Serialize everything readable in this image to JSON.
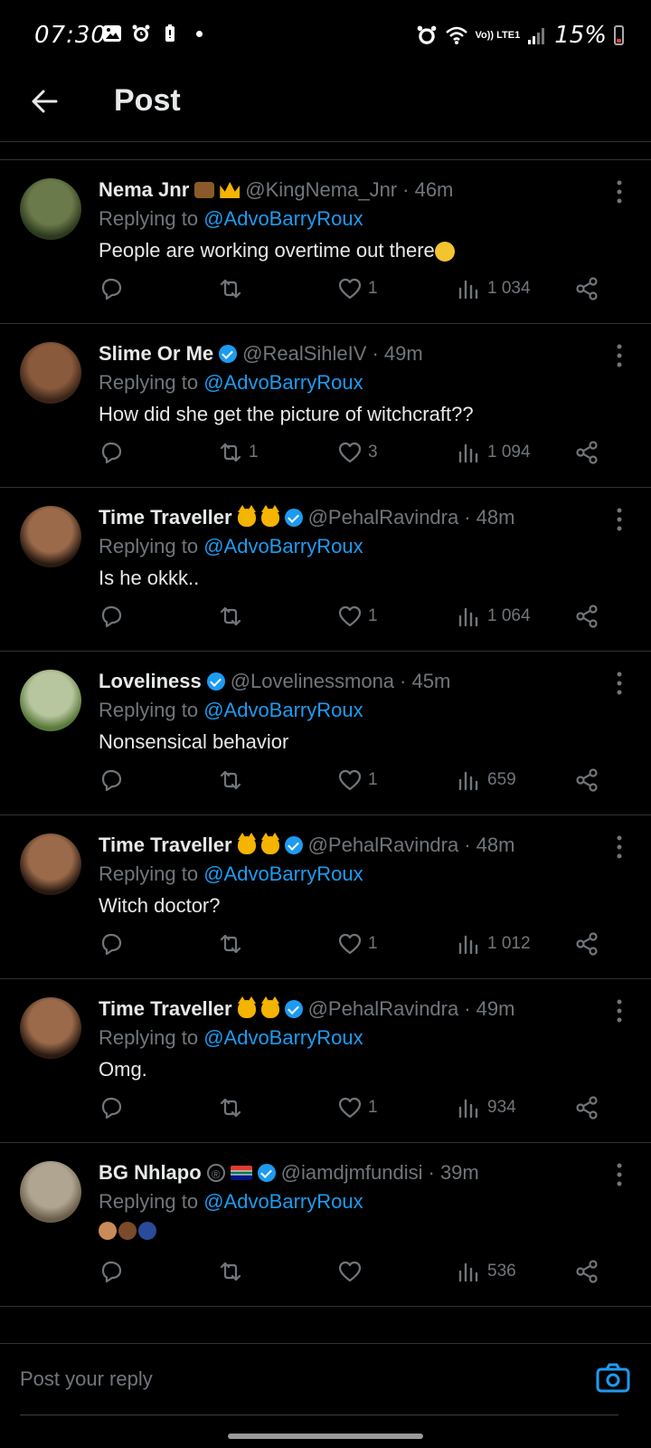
{
  "status_bar": {
    "time": "07:30",
    "network": "Vo)) LTE1",
    "battery": "15%"
  },
  "header": {
    "title": "Post"
  },
  "replies": [
    {
      "name": "Nema Jnr",
      "handle": "@KingNema_Jnr",
      "age": "· 46m",
      "replying_prefix": "Replying to",
      "mention": "@AdvoBarryRoux",
      "text": "People are working overtime out there",
      "retweets": "",
      "likes": "1",
      "views": "1 034"
    },
    {
      "name": "Slime Or Me",
      "handle": "@RealSihleIV",
      "age": "· 49m",
      "replying_prefix": "Replying to",
      "mention": "@AdvoBarryRoux",
      "text": "How did she get the picture of witchcraft??",
      "retweets": "1",
      "likes": "3",
      "views": "1 094"
    },
    {
      "name": "Time Traveller",
      "handle": "@PehalRavindra",
      "age": "· 48m",
      "replying_prefix": "Replying to",
      "mention": "@AdvoBarryRoux",
      "text": "Is he okkk..",
      "retweets": "",
      "likes": "1",
      "views": "1 064"
    },
    {
      "name": "Loveliness",
      "handle": "@Lovelinessmona",
      "age": "· 45m",
      "replying_prefix": "Replying to",
      "mention": "@AdvoBarryRoux",
      "text": "Nonsensical behavior",
      "retweets": "",
      "likes": "1",
      "views": "659"
    },
    {
      "name": "Time Traveller",
      "handle": "@PehalRavindra",
      "age": "· 48m",
      "replying_prefix": "Replying to",
      "mention": "@AdvoBarryRoux",
      "text": "Witch doctor?",
      "retweets": "",
      "likes": "1",
      "views": "1 012"
    },
    {
      "name": "Time Traveller",
      "handle": "@PehalRavindra",
      "age": "· 49m",
      "replying_prefix": "Replying to",
      "mention": "@AdvoBarryRoux",
      "text": "Omg.",
      "retweets": "",
      "likes": "1",
      "views": "934"
    },
    {
      "name": "BG Nhlapo",
      "handle": "@iamdjmfundisi",
      "age": "· 39m",
      "replying_prefix": "Replying to",
      "mention": "@AdvoBarryRoux",
      "text": "",
      "retweets": "",
      "likes": "",
      "views": "536"
    }
  ],
  "compose": {
    "placeholder": "Post your reply"
  },
  "colors": {
    "background": "#000000",
    "accent": "#1d9bf0",
    "muted": "#71767b",
    "text": "#e7e9ea"
  }
}
